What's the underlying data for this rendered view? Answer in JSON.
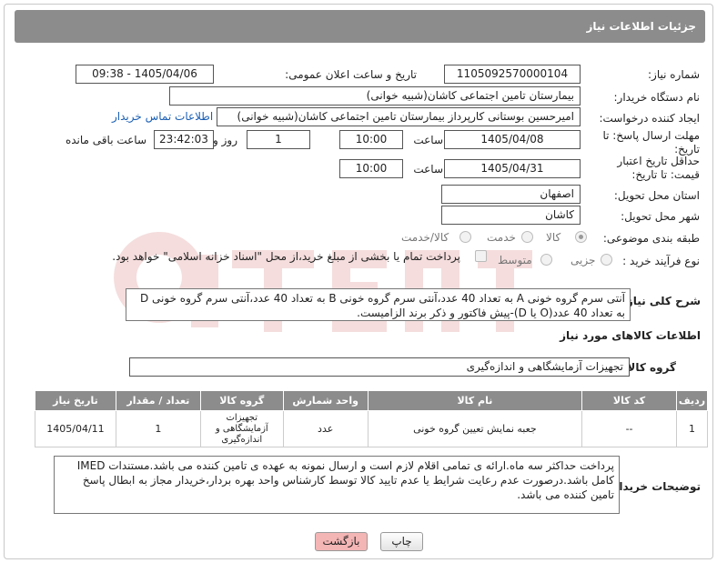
{
  "header": {
    "title": "جزئیات اطلاعات نیاز"
  },
  "form": {
    "need_number_label": "شماره نیاز:",
    "need_number": "1105092570000104",
    "announce_label": "تاریخ و ساعت اعلان عمومی:",
    "announce_value": "1405/04/06 - 09:38",
    "buyer_label": "نام دستگاه خریدار:",
    "buyer_value": "بیمارستان تامین اجتماعی کاشان(شبیه خوانی)",
    "creator_label": "ایجاد کننده درخواست:",
    "creator_value": "امیرحسین بوستانی کارپرداز بیمارستان تامین اجتماعی کاشان(شبیه خوانی)",
    "contact_link": "اطلاعات تماس خریدار",
    "deadline_label": "مهلت ارسال پاسخ: تا تاریخ:",
    "deadline_date": "1405/04/08",
    "time_label": "ساعت",
    "deadline_time": "10:00",
    "days_value": "1",
    "days_label": "روز و",
    "remaining_time": "23:42:03",
    "remaining_label": "ساعت باقی مانده",
    "validity_label": "حداقل تاریخ اعتبار قیمت: تا تاریخ:",
    "validity_date": "1405/04/31",
    "validity_time": "10:00",
    "province_label": "استان محل تحویل:",
    "province_value": "اصفهان",
    "city_label": "شهر محل تحویل:",
    "city_value": "کاشان",
    "category_label": "طبقه بندی موضوعی:",
    "category_options": [
      "کالا",
      "خدمت",
      "کالا/خدمت"
    ],
    "category_selected": "کالا",
    "process_label": "نوع فرآیند خرید :",
    "process_options": [
      "جزیی",
      "متوسط"
    ],
    "payment_text": "پرداخت تمام یا بخشی از مبلغ خرید،از محل \"اسناد خزانه اسلامی\" خواهد بود."
  },
  "description": {
    "label": "شرح کلی نیاز:",
    "text": "آنتی سرم گروه خونی A به تعداد 40 عدد،آنتی سرم گروه خونی B به تعداد 40 عدد،آنتی سرم گروه خونی D به تعداد 40 عدد(O یا D)-پیش فاکتور و ذکر برند الزامیست."
  },
  "goods_section": {
    "title": "اطلاعات کالاهای مورد نیاز",
    "group_label": "گروه کالا:",
    "group_value": "تجهیزات آزمایشگاهی و اندازه‌گیری"
  },
  "table": {
    "headers": [
      "ردیف",
      "کد کالا",
      "نام کالا",
      "واحد شمارش",
      "گروه کالا",
      "تعداد / مقدار",
      "تاریخ نیاز"
    ],
    "rows": [
      {
        "row": "1",
        "code": "--",
        "name": "جعبه نمایش تعیین گروه خونی",
        "unit": "عدد",
        "group": "تجهیزات آزمایشگاهی و اندازه‌گیری",
        "qty": "1",
        "date": "1405/04/11"
      }
    ]
  },
  "buyer_notes": {
    "label": "توضیحات خریدار:",
    "text": "پرداخت حداکثر سه ماه.ارائه ی تمامی اقلام لازم است و ارسال نمونه به عهده ی تامین کننده می باشد.مستندات IMED کامل باشد.درصورت عدم رعایت شرایط یا عدم تایید کالا توسط کارشناس واحد بهره بردار،خریدار مجاز به ابطال پاسخ تامین کننده می باشد."
  },
  "buttons": {
    "print": "چاپ",
    "back": "بازگشت"
  },
  "colors": {
    "header_bg": "#8c8c8c",
    "link": "#1a5fb4",
    "back_button": "#f4b5b5"
  }
}
